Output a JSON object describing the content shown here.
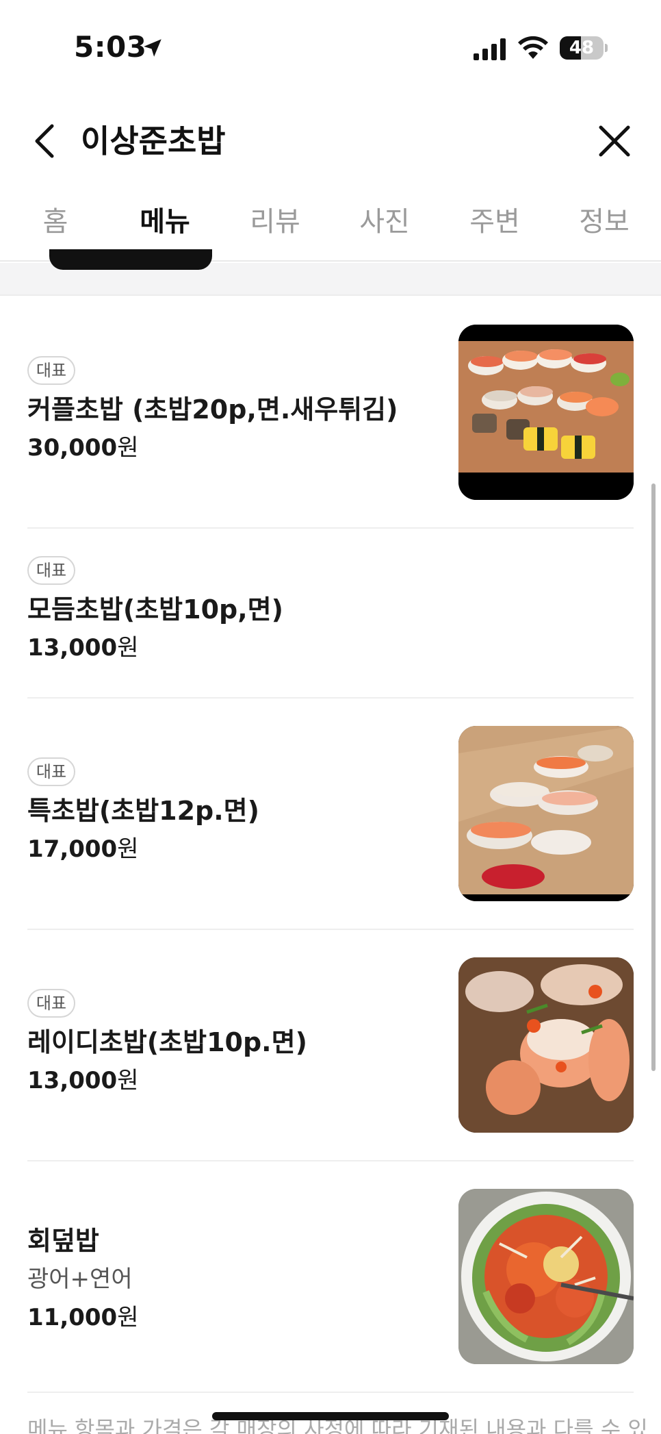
{
  "status_bar": {
    "time": "5:03",
    "battery": "48",
    "icons": [
      "location-arrow-icon",
      "cellular-signal-icon",
      "wifi-icon",
      "battery-icon"
    ]
  },
  "header": {
    "title": "이상준초밥",
    "back_icon": "chevron-left-icon",
    "close_icon": "close-icon"
  },
  "tabs": [
    {
      "label": "홈",
      "active": false
    },
    {
      "label": "메뉴",
      "active": true
    },
    {
      "label": "리뷰",
      "active": false
    },
    {
      "label": "사진",
      "active": false
    },
    {
      "label": "주변",
      "active": false
    },
    {
      "label": "정보",
      "active": false
    }
  ],
  "menu_items": [
    {
      "badge": "대표",
      "name": "커플초밥 (초밥20p,면.새우튀김)",
      "price_num": "30,000",
      "price_unit": "원",
      "image": "sushi-platter-photo"
    },
    {
      "badge": "대표",
      "name": "모듬초밥(초밥10p,면)",
      "price_num": "13,000",
      "price_unit": "원"
    },
    {
      "badge": "대표",
      "name": "특초밥(초밥12p.면)",
      "price_num": "17,000",
      "price_unit": "원",
      "image": "sushi-board-photo"
    },
    {
      "badge": "대표",
      "name": "레이디초밥(초밥10p.면)",
      "price_num": "13,000",
      "price_unit": "원",
      "image": "torched-salmon-sushi-photo"
    },
    {
      "name": "회덮밥",
      "desc": "광어+연어",
      "price_num": "11,000",
      "price_unit": "원",
      "image": "hoedeopbap-bowl-photo"
    }
  ],
  "footer_note": "메뉴 항목과 가격은 각 매장의 사정에 따라 기재된 내용과 다를 수 있"
}
